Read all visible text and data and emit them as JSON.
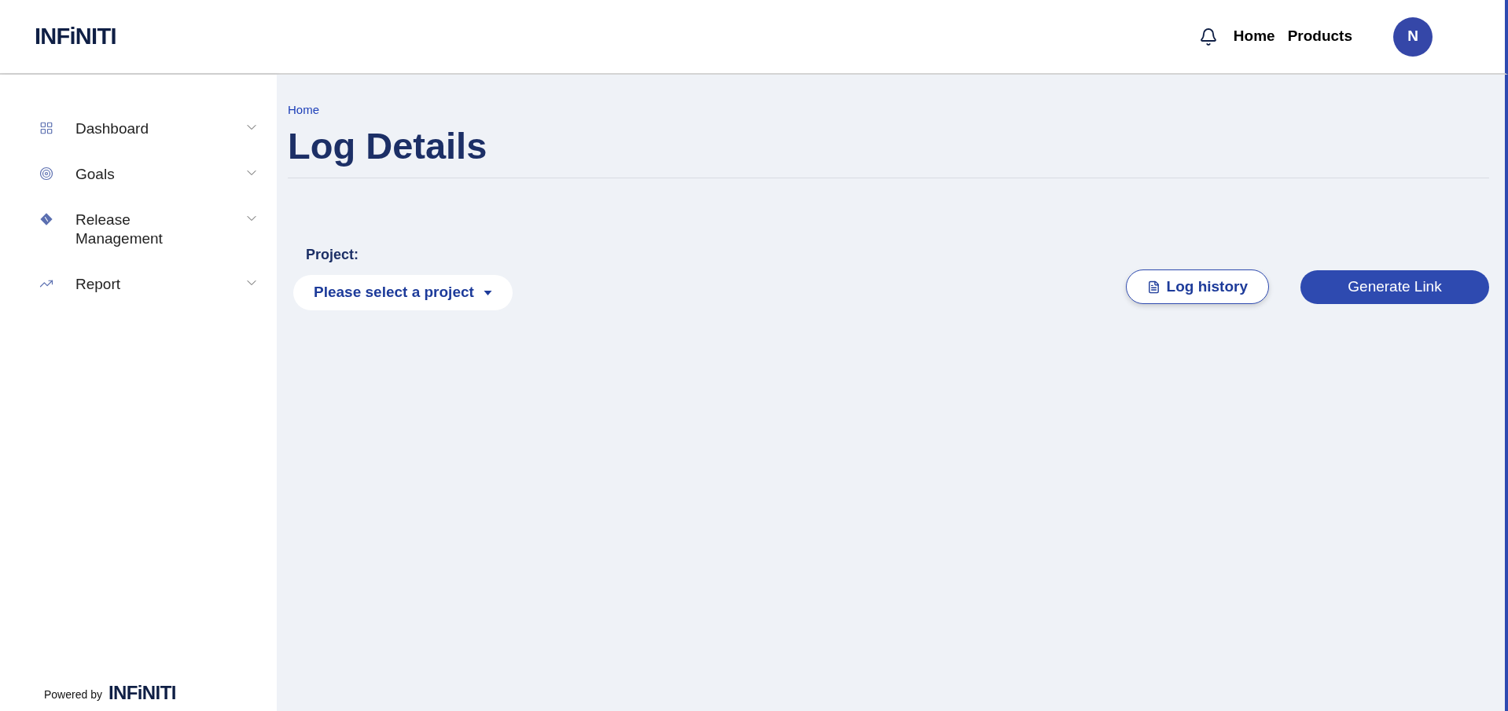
{
  "header": {
    "logo": "INFiNITI",
    "nav": [
      "Home",
      "Products"
    ],
    "avatar": "N"
  },
  "sidebar": {
    "items": [
      {
        "label": "Dashboard",
        "kind": "grid"
      },
      {
        "label": "Goals",
        "kind": "target"
      },
      {
        "label": "Release Management",
        "kind": "release"
      },
      {
        "label": "Report",
        "kind": "trend"
      }
    ],
    "footer": {
      "text": "Powered by",
      "logo": "INFiNITI"
    }
  },
  "main": {
    "breadcrumb": "Home",
    "title": "Log Details",
    "project_label": "Project:",
    "project_select": {
      "value": "Please select a project"
    },
    "buttons": [
      {
        "label": "Log history",
        "kind": "outline"
      },
      {
        "label": "Generate Link",
        "kind": "primary"
      }
    ]
  }
}
